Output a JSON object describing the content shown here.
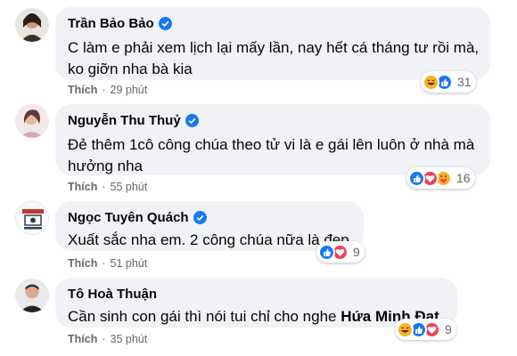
{
  "comments": [
    {
      "name": "Trần Bảo Bảo",
      "verified": true,
      "text": "C làm e phải xem lịch lại mấy lần, nay hết cá tháng tư rồi mà, ko giỡn nha bà kia",
      "like": "Thích",
      "time": "29 phút",
      "reactions": [
        "haha",
        "like"
      ],
      "reaction_count": "31"
    },
    {
      "name": "Nguyễn Thu Thuỷ",
      "verified": true,
      "text": "Đẻ thêm 1cô công chúa theo tử vi là e gái lên luôn ở nhà mà hưởng nha",
      "like": "Thích",
      "time": "55 phút",
      "reactions": [
        "like",
        "love",
        "care"
      ],
      "reaction_count": "16"
    },
    {
      "name": "Ngọc Tuyên Quách",
      "verified": true,
      "text": "Xuất sắc nha em. 2 công chúa nữa là đẹp",
      "like": "Thích",
      "time": "51 phút",
      "reactions": [
        "like",
        "love"
      ],
      "reaction_count": "9"
    },
    {
      "name": "Tô Hoà Thuận",
      "verified": false,
      "text": "Cần sinh con gái thì nói tui chỉ cho nghe",
      "tag": "Hứa Minh Đạt",
      "like": "Thích",
      "time": "35 phút",
      "reactions": [
        "haha",
        "like",
        "love"
      ],
      "reaction_count": "9"
    }
  ],
  "separator": "·",
  "colors": {
    "like": "#1877f2",
    "love": "#f33e58",
    "haha": "#f7b125",
    "bubble": "#f0f2f5",
    "verified": "#1877f2"
  }
}
